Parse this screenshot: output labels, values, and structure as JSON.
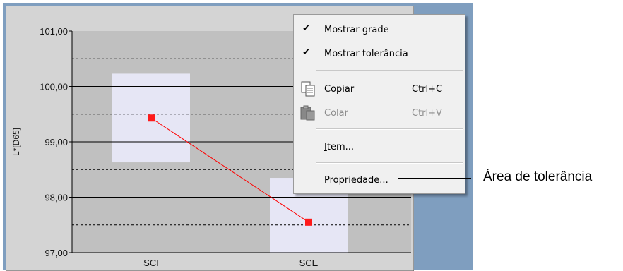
{
  "chart_data": {
    "type": "line",
    "ylabel": "L*[D65]",
    "ylim": [
      97.0,
      101.0
    ],
    "yticks": [
      "101,00",
      "100,00",
      "99,00",
      "98,00",
      "97,00"
    ],
    "categories": [
      "SCI",
      "SCE"
    ],
    "values": [
      99.43,
      97.55
    ],
    "tolerance_boxes": [
      {
        "category": "SCI",
        "low": 98.63,
        "high": 100.23
      },
      {
        "category": "SCE",
        "low": 97.0,
        "high": 98.35
      }
    ],
    "grid": true,
    "colors": {
      "line": "#ff0000",
      "marker": "#ff1a1a",
      "plot_bg": "#c0c0c0",
      "tolerance": "#e6e6f5"
    }
  },
  "menu": {
    "show_grid": {
      "label": "Mostrar grade",
      "checked": true,
      "check_glyph": "✔"
    },
    "show_tolerance": {
      "label": "Mostrar tolerância",
      "checked": true,
      "check_glyph": "✔"
    },
    "copy": {
      "label": "Copiar",
      "shortcut": "Ctrl+C",
      "icon": "copy-icon"
    },
    "paste": {
      "label": "Colar",
      "shortcut": "Ctrl+V",
      "icon": "paste-icon",
      "disabled": true
    },
    "item": {
      "label_first": "I",
      "label_rest": "tem..."
    },
    "property": {
      "label": "Propriedade..."
    }
  },
  "callout": {
    "text": "Área de tolerância"
  },
  "colors": {
    "panel_bg": "#7f9ebf",
    "menu_bg": "#f0f0f0"
  }
}
